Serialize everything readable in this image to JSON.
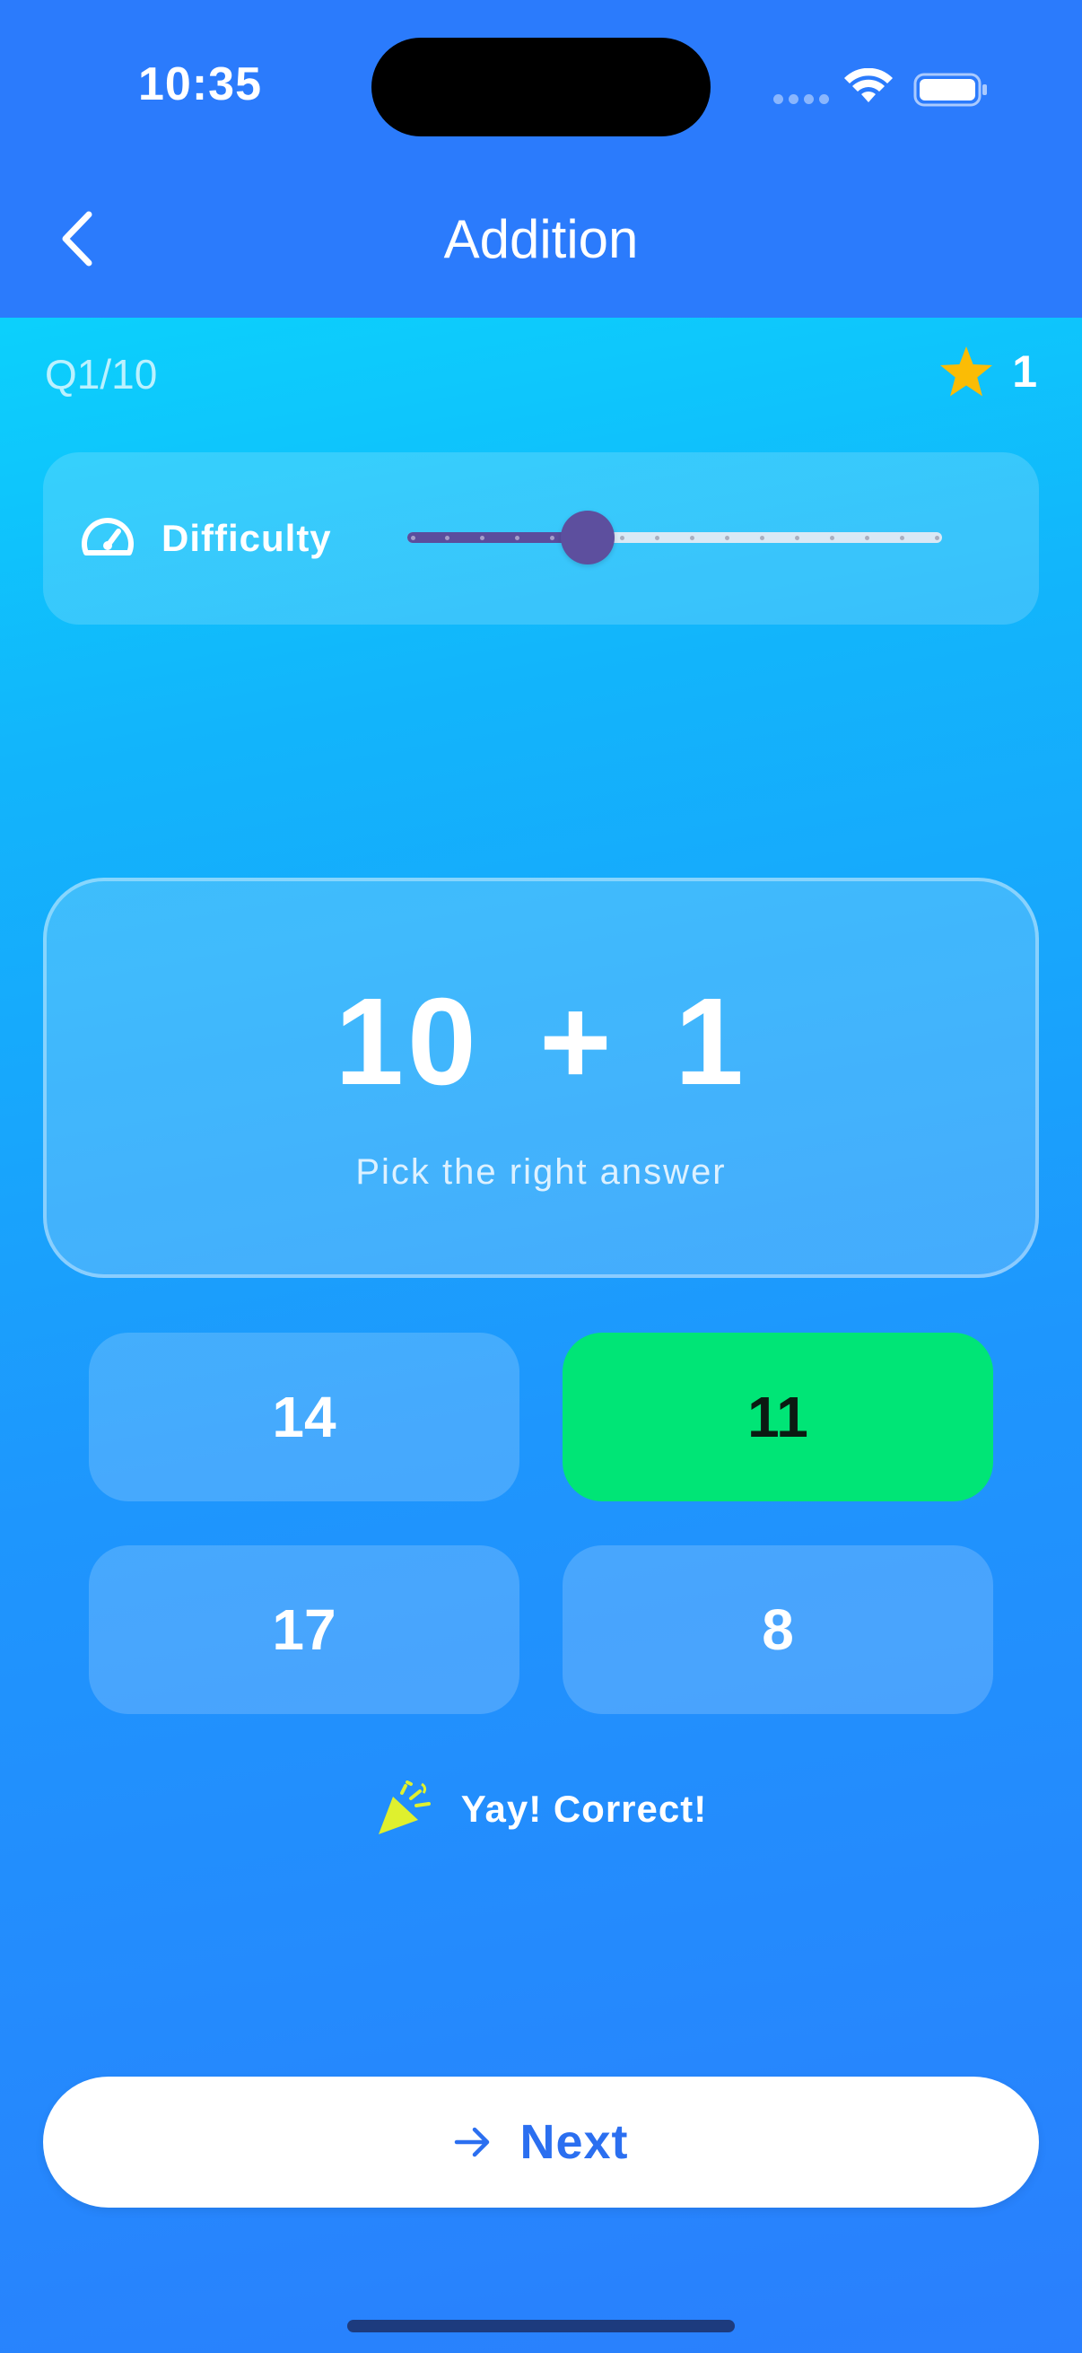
{
  "status_bar": {
    "time": "10:35"
  },
  "header": {
    "title": "Addition",
    "back_icon": "chevron-left-icon"
  },
  "progress": {
    "question_counter": "Q1/10",
    "stars": "1",
    "star_color": "#fbbc05"
  },
  "difficulty": {
    "label": "Difficulty",
    "level": 6,
    "min": 1,
    "max": 16,
    "fill_color": "#5b4d9d"
  },
  "problem": {
    "expression": "10 + 1",
    "hint": "Pick the right answer"
  },
  "answers": [
    {
      "label": "14",
      "state": "default"
    },
    {
      "label": "11",
      "state": "correct"
    },
    {
      "label": "17",
      "state": "default"
    },
    {
      "label": "8",
      "state": "default"
    }
  ],
  "feedback": {
    "text": "Yay! Correct!",
    "icon": "party-popper-icon"
  },
  "next_button": {
    "label": "Next",
    "icon": "arrow-right-icon"
  },
  "colors": {
    "correct": "#00e576",
    "accent": "#2b6ff0",
    "header": "#2b7bfc"
  }
}
